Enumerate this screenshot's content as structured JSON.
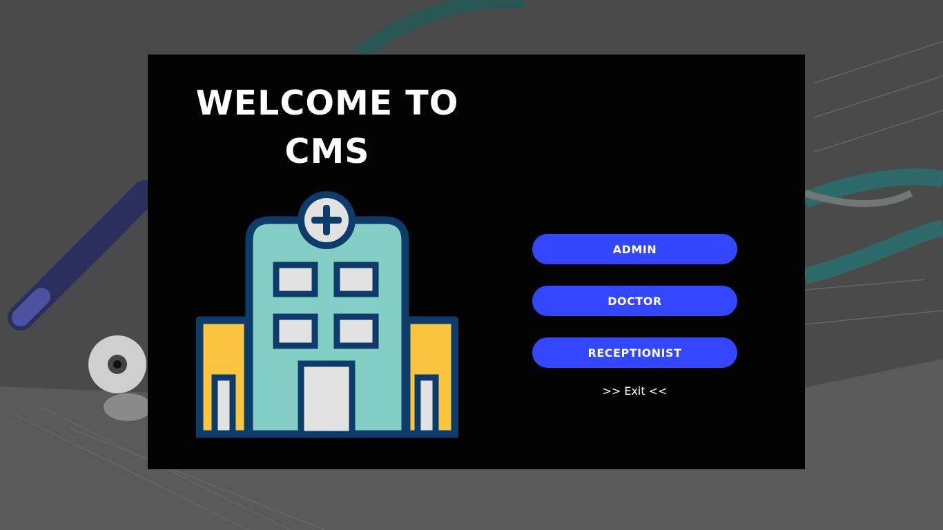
{
  "welcome": {
    "title_line1": "WELCOME TO",
    "title_line2": "CMS"
  },
  "buttons": {
    "admin": "ADMIN",
    "doctor": "DOCTOR",
    "receptionist": "RECEPTIONIST"
  },
  "exit_link": ">> Exit <<",
  "colors": {
    "panel": "#030303",
    "button": "#3347ff",
    "building_body": "#85cec6",
    "building_wings": "#fbc540",
    "building_outline": "#0d3c6b",
    "windows": "#e2e2e2"
  }
}
